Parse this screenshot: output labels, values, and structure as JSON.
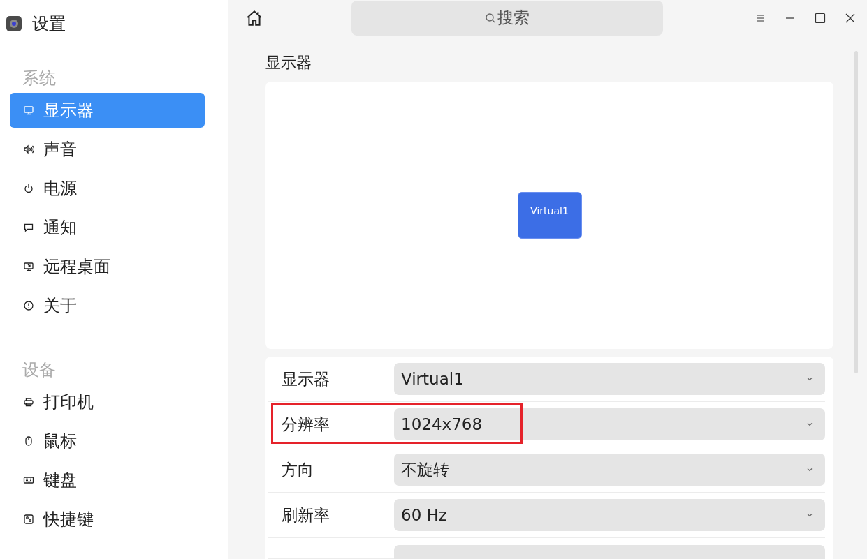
{
  "window": {
    "title": "设置"
  },
  "search": {
    "placeholder": "搜索"
  },
  "sidebar": {
    "sections": [
      {
        "title": "系统",
        "items": [
          {
            "label": "显示器",
            "selected": true
          },
          {
            "label": "声音",
            "selected": false
          },
          {
            "label": "电源",
            "selected": false
          },
          {
            "label": "通知",
            "selected": false
          },
          {
            "label": "远程桌面",
            "selected": false
          },
          {
            "label": "关于",
            "selected": false
          }
        ]
      },
      {
        "title": "设备",
        "items": [
          {
            "label": "打印机",
            "selected": false
          },
          {
            "label": "鼠标",
            "selected": false
          },
          {
            "label": "键盘",
            "selected": false
          },
          {
            "label": "快捷键",
            "selected": false
          }
        ]
      }
    ]
  },
  "page": {
    "title": "显示器",
    "monitors": [
      {
        "name": "Virtual1"
      }
    ],
    "rows": [
      {
        "kind": "select",
        "label": "显示器",
        "value": "Virtual1",
        "highlighted": false
      },
      {
        "kind": "select",
        "label": "分辨率",
        "value": "1024x768",
        "highlighted": true
      },
      {
        "kind": "select",
        "label": "方向",
        "value": "不旋转",
        "highlighted": false
      },
      {
        "kind": "select",
        "label": "刷新率",
        "value": "60 Hz",
        "highlighted": false
      },
      {
        "kind": "partial",
        "highlighted": false
      }
    ]
  }
}
